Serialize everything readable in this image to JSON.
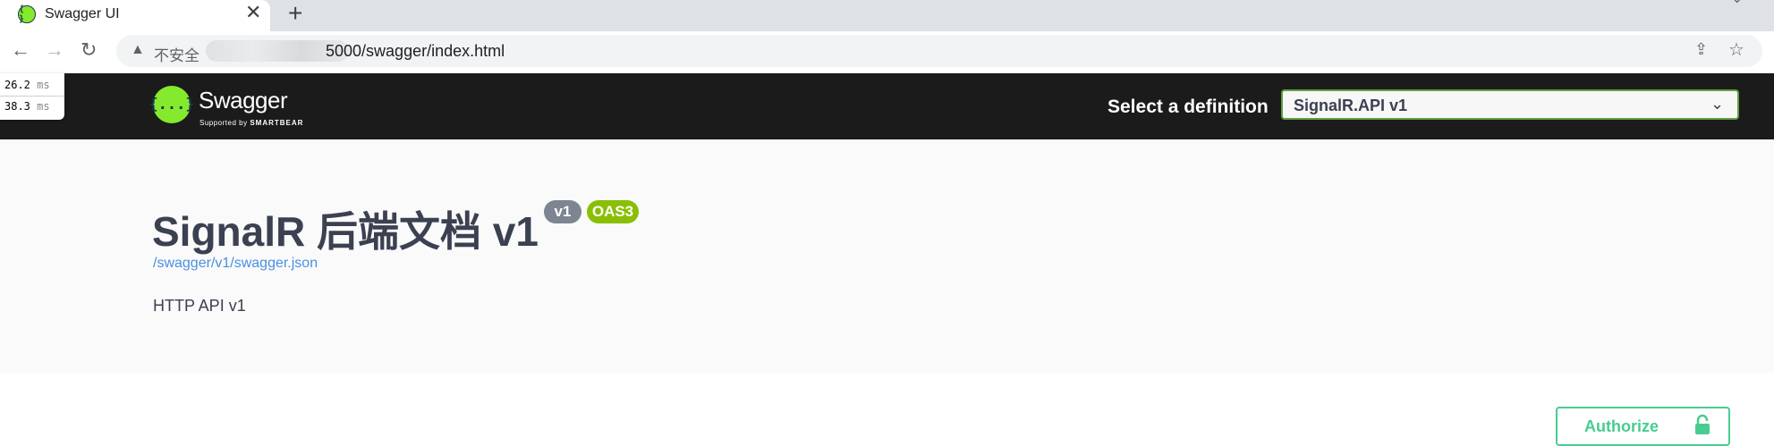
{
  "browser": {
    "tab_title": "Swagger UI",
    "tab_favicon": "{ }",
    "tab_close": "✕",
    "new_tab": "+",
    "insecure_label": "不安全",
    "url_visible": "5000/swagger/index.html"
  },
  "perf": {
    "row1_value": "26.2",
    "row2_value": "38.3",
    "unit": "ms"
  },
  "topbar": {
    "logo_glyph": "{...}",
    "logo_text": "Swagger",
    "logo_sub_prefix": "Supported by",
    "logo_sub_brand": "SMARTBEAR",
    "select_label": "Select a definition",
    "selected_definition": "SignalR.API v1"
  },
  "info": {
    "title": "SignalR 后端文档 v1",
    "version_badge": "v1",
    "oas_badge": "OAS3",
    "spec_link": "/swagger/v1/swagger.json",
    "description": "HTTP API v1"
  },
  "auth": {
    "authorize_label": "Authorize"
  },
  "colors": {
    "topbar_bg": "#1b1b1b",
    "swagger_green": "#85ea2d",
    "select_border": "#62a03f",
    "version_badge": "#7d8492",
    "oas_badge": "#89bf04",
    "link": "#4990e2",
    "authorize": "#49cc90"
  },
  "icons": [
    "swagger-favicon-icon",
    "close-icon",
    "plus-icon",
    "back-arrow-icon",
    "forward-arrow-icon",
    "reload-icon",
    "warning-icon",
    "share-icon",
    "star-icon",
    "chevron-down-icon",
    "lock-icon"
  ]
}
